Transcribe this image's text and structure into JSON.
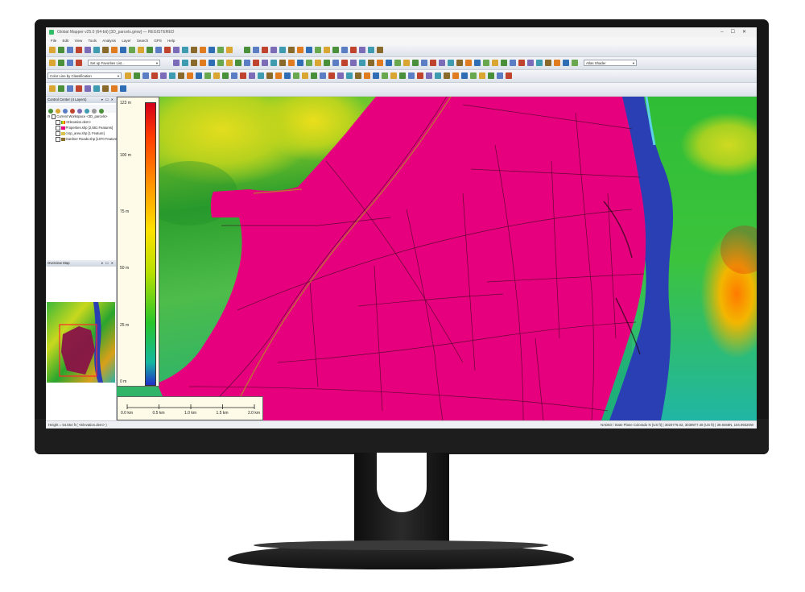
{
  "app": {
    "title": "Global Mapper v25.0 (64-bit) [3D_parcels.gmw] — REGISTERED",
    "window_controls": [
      "–",
      "☐",
      "✕"
    ]
  },
  "menu": [
    "File",
    "Edit",
    "View",
    "Tools",
    "Analysis",
    "Layer",
    "Search",
    "GPS",
    "Help"
  ],
  "toolbar": {
    "setup_combo": "Set up Favorites List...",
    "shader_combo": "Atlas Shader",
    "color_combo": "Color Line by Classification"
  },
  "control_center": {
    "title": "Control Center (4 Layers)",
    "workspace": "Current Workspace <3D_parcels>",
    "layers": [
      {
        "name": "<Elevation.dem>",
        "checked": true
      },
      {
        "name": "Properties.shp [2,681 Features]",
        "checked": true
      },
      {
        "name": "crop_area.shp [1 Feature]",
        "checked": true
      },
      {
        "name": "Gardner Roads.shp [1070 Features]",
        "checked": true
      }
    ]
  },
  "overview": {
    "title": "Overview Map"
  },
  "legend": {
    "ticks": [
      "123 m",
      "100 m",
      "75 m",
      "50 m",
      "25 m",
      "0 m"
    ],
    "tick_values": [
      123,
      100,
      75,
      50,
      25,
      0
    ],
    "colors": {
      "high": "#d4001a",
      "mid": "#ffe100",
      "low": "#2130c8"
    }
  },
  "scale": {
    "labels": [
      "0.0 km",
      "0.5 km",
      "1.0 km",
      "1.5 km",
      "2.0 km"
    ],
    "values": [
      0,
      0.5,
      1.0,
      1.5,
      2.0
    ]
  },
  "map": {
    "parcel_color": "#e6007e",
    "water_color": "#2b3fb5",
    "road_color": "#2a0a10"
  },
  "status": {
    "left": "Height = 54.554 ft ( <Elevation.dem> )",
    "right": "NAD83 / State Plane Colorado N (US ft) | 3020776.02, 3039977.48 (US ft) | 39.8468N, 104.99320W"
  }
}
